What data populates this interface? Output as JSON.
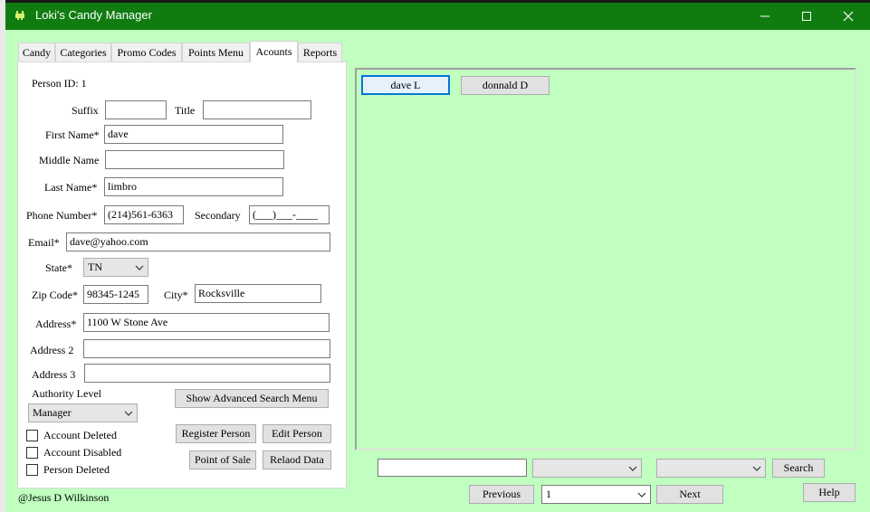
{
  "window": {
    "title": "Loki's Candy Manager",
    "title_bar_color": "#107c10",
    "background_color": "#c0ffc0",
    "controls": {
      "minimize_icon": "minimize-icon",
      "maximize_icon": "maximize-icon",
      "close_icon": "close-icon"
    }
  },
  "tabs": [
    {
      "label": "Candy",
      "active": false
    },
    {
      "label": "Categories",
      "active": false
    },
    {
      "label": "Promo Codes",
      "active": false
    },
    {
      "label": "Points Menu",
      "active": false
    },
    {
      "label": "Acounts",
      "active": true
    },
    {
      "label": "Reports",
      "active": false
    }
  ],
  "form": {
    "person_id_label": "Person ID: 1",
    "suffix": {
      "label": "Suffix",
      "value": ""
    },
    "title": {
      "label": "Title",
      "value": ""
    },
    "first_name": {
      "label": "First Name*",
      "value": "dave"
    },
    "middle_name": {
      "label": "Middle Name",
      "value": ""
    },
    "last_name": {
      "label": "Last Name*",
      "value": "limbro"
    },
    "phone": {
      "label": "Phone Number*",
      "value": "(214)561-6363"
    },
    "secondary": {
      "label": "Secondary",
      "value": "(___)___-____"
    },
    "email": {
      "label": "Email*",
      "value": "dave@yahoo.com"
    },
    "state": {
      "label": "State*",
      "value": "TN"
    },
    "zip": {
      "label": "Zip Code*",
      "value": "98345-1245"
    },
    "city": {
      "label": "City*",
      "value": "Rocksville"
    },
    "address1": {
      "label": "Address*",
      "value": "1100 W Stone Ave"
    },
    "address2": {
      "label": "Address 2",
      "value": ""
    },
    "address3": {
      "label": "Address 3",
      "value": ""
    },
    "authority": {
      "label": "Authority Level",
      "value": "Manager"
    },
    "checkboxes": [
      {
        "label": "Account Deleted",
        "checked": false
      },
      {
        "label": "Account Disabled",
        "checked": false
      },
      {
        "label": "Person Deleted",
        "checked": false
      }
    ],
    "buttons": {
      "advanced_search": "Show Advanced Search Menu",
      "register": "Register Person",
      "edit": "Edit Person",
      "point_of_sale": "Point of Sale",
      "reload": "Relaod Data"
    }
  },
  "results": {
    "persons": [
      "dave L",
      "donnald D"
    ]
  },
  "search_bar": {
    "text_value": "",
    "filter1_value": "",
    "filter2_value": "",
    "search_label": "Search",
    "previous_label": "Previous",
    "page_value": "1",
    "next_label": "Next",
    "help_label": "Help"
  },
  "footer": {
    "credit": "@Jesus D Wilkinson"
  }
}
